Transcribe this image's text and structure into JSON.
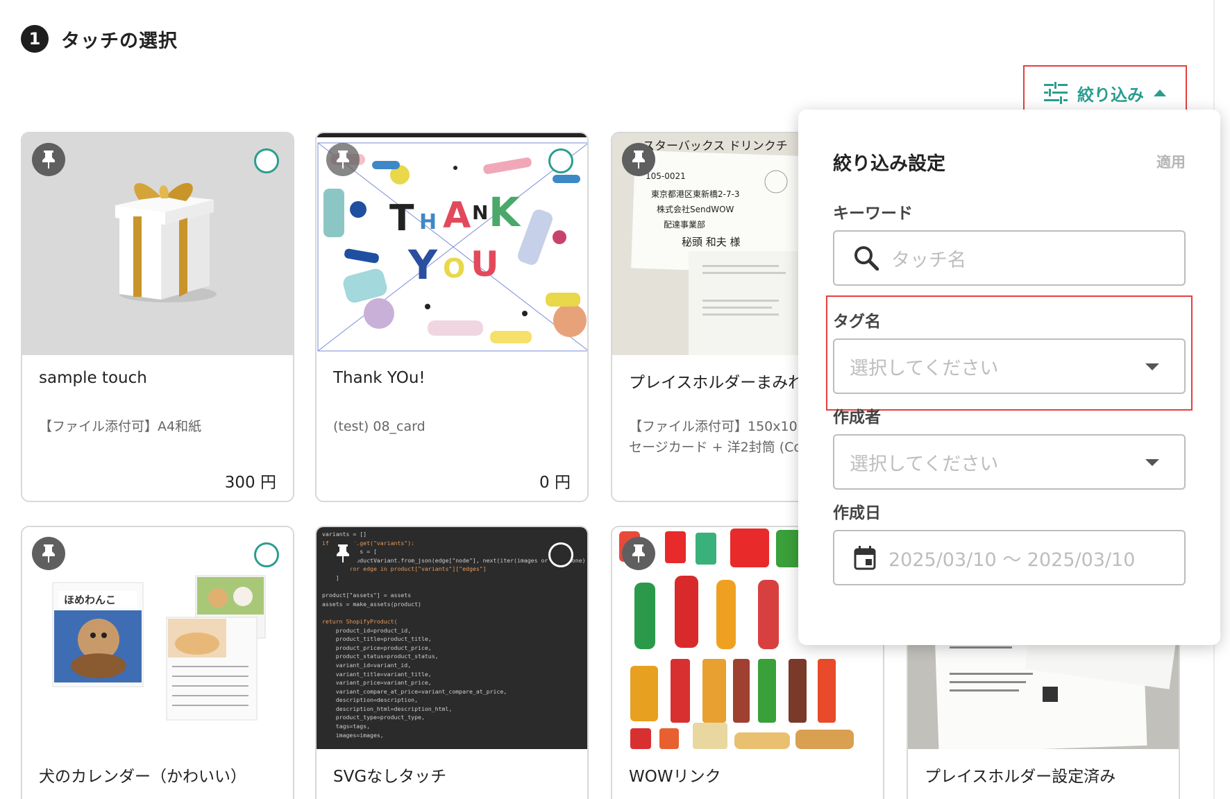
{
  "step": {
    "number": "1",
    "title": "タッチの選択"
  },
  "filter_toggle": {
    "label": "絞り込み"
  },
  "filter_panel": {
    "title": "絞り込み設定",
    "apply_label": "適用",
    "keyword": {
      "label": "キーワード",
      "placeholder": "タッチ名"
    },
    "tag": {
      "label": "タグ名",
      "placeholder": "選択してください"
    },
    "author": {
      "label": "作成者",
      "placeholder": "選択してください"
    },
    "created": {
      "label": "作成日",
      "placeholder": "2025/03/10 〜 2025/03/10"
    }
  },
  "cards": [
    {
      "name": "sample touch",
      "desc": "【ファイル添付可】A4和紙",
      "price": "300 円"
    },
    {
      "name": "Thank YOu!",
      "desc": "(test) 08_card",
      "price": "0 円"
    },
    {
      "name": "プレイスホルダーまみれ",
      "desc1": "【ファイル添付可】150x10",
      "desc2": "セージカード + 洋2封筒 (Co",
      "banner": "スターバックス ドリンクチ"
    },
    {
      "name": "犬のカレンダー（かわいい）"
    },
    {
      "name": "SVGなしタッチ"
    },
    {
      "name": "WOWリンク"
    },
    {
      "name": "プレイスホルダー設定済み"
    }
  ],
  "thumb_text": {
    "thank": [
      "T",
      "H",
      "A",
      "N",
      "K",
      "Y",
      "O",
      "U"
    ],
    "letter_lines": [
      "105-0021",
      "東京都港区東新橋2-7-3",
      "株式会社SendWOW",
      "配達事業部",
      "秘頭 和夫 様"
    ],
    "calendar": "ほめわんこ",
    "code_lines": [
      "variants = []",
      "if product.get(\"variants\"):",
      "    variants = [",
      "        ProductVariant.from_json(edge[\"node\"], next(iter(images or []), None)",
      "        for edge in product[\"variants\"][\"edges\"]",
      "    ]",
      "",
      "product[\"assets\"] = assets",
      "assets = make_assets(product)",
      "",
      "return ShopifyProduct(",
      "    product_id=product_id,",
      "    product_title=product_title,",
      "    product_price=product_price,",
      "    product_status=product_status,",
      "    variant_id=variant_id,",
      "    variant_title=variant_title,",
      "    variant_price=variant_price,",
      "    variant_compare_at_price=variant_compare_at_price,",
      "    description=description,",
      "    description_html=description_html,",
      "    product_type=product_type,",
      "    tags=tags,",
      "    images=images,"
    ]
  },
  "colors": {
    "accent": "#2a9d8f",
    "highlight": "#e53e3e",
    "pin": "#5f5f5f"
  }
}
